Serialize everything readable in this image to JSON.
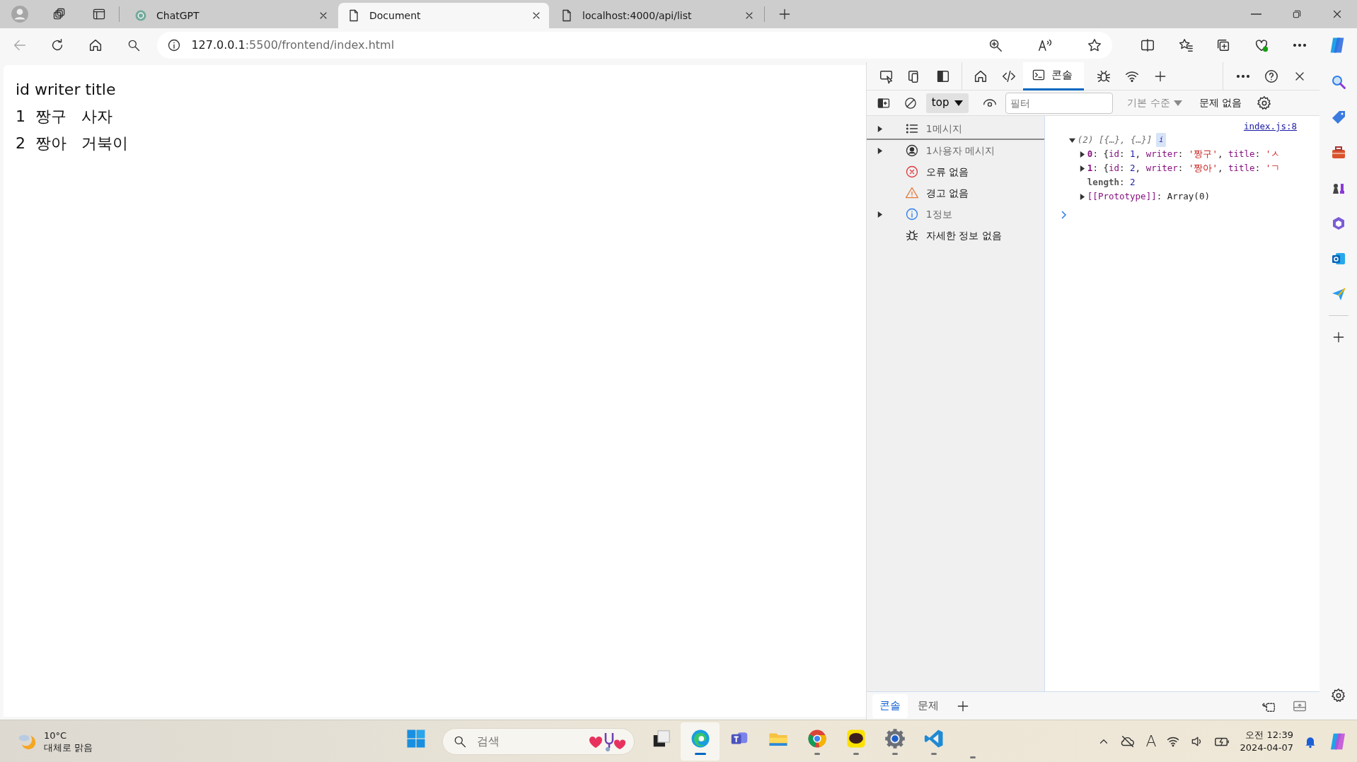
{
  "browser": {
    "tabs": [
      {
        "title": "ChatGPT",
        "kind": "chatgpt",
        "selected": false
      },
      {
        "title": "Document",
        "kind": "page",
        "selected": true
      },
      {
        "title": "localhost:4000/api/list",
        "kind": "page",
        "selected": false
      }
    ],
    "url": {
      "host": "127.0.0.1",
      "path": ":5500/frontend/index.html"
    }
  },
  "page": {
    "lines": [
      "id writer title",
      "1  짱구   사자",
      "2  짱아   거북이"
    ]
  },
  "devtools": {
    "tabs": [
      {
        "label": "콘솔",
        "selected": true
      }
    ],
    "toolbar": {
      "context": "top",
      "filter_placeholder": "필터",
      "levels": "기본 수준",
      "issues": "문제 없음"
    },
    "sidebar": [
      {
        "kind": "list",
        "label": "1메시지",
        "expandable": true,
        "selected": true
      },
      {
        "kind": "user",
        "label": "1사용자 메시지",
        "expandable": true,
        "selected": false
      },
      {
        "kind": "error",
        "label": "오류 없음",
        "expandable": false,
        "selected": false
      },
      {
        "kind": "warning",
        "label": "경고 없음",
        "expandable": false,
        "selected": false
      },
      {
        "kind": "info",
        "label": "1정보",
        "expandable": true,
        "selected": false
      },
      {
        "kind": "verbose",
        "label": "자세한 정보 없음",
        "expandable": false,
        "selected": false
      }
    ],
    "console": {
      "source": "index.js:8",
      "entries": [
        {
          "expandable": true,
          "expanded": true,
          "tokens": [
            {
              "kind": "meta",
              "text": "(2) [{…}, {…}]"
            }
          ],
          "badge": "i",
          "children": [
            {
              "expandable": true,
              "expanded": false,
              "tokens": [
                {
                  "kind": "index",
                  "text": "0"
                },
                {
                  "kind": "punct",
                  "text": ": {"
                },
                {
                  "kind": "key",
                  "text": "id"
                },
                {
                  "kind": "punct",
                  "text": ": "
                },
                {
                  "kind": "number",
                  "text": "1"
                },
                {
                  "kind": "punct",
                  "text": ", "
                },
                {
                  "kind": "key",
                  "text": "writer"
                },
                {
                  "kind": "punct",
                  "text": ": "
                },
                {
                  "kind": "string",
                  "text": "'짱구'"
                },
                {
                  "kind": "punct",
                  "text": ", "
                },
                {
                  "kind": "key",
                  "text": "title"
                },
                {
                  "kind": "punct",
                  "text": ": "
                },
                {
                  "kind": "string",
                  "text": "'ㅅ"
                }
              ]
            },
            {
              "expandable": true,
              "expanded": false,
              "tokens": [
                {
                  "kind": "index",
                  "text": "1"
                },
                {
                  "kind": "punct",
                  "text": ": {"
                },
                {
                  "kind": "key",
                  "text": "id"
                },
                {
                  "kind": "punct",
                  "text": ": "
                },
                {
                  "kind": "number",
                  "text": "2"
                },
                {
                  "kind": "punct",
                  "text": ", "
                },
                {
                  "kind": "key",
                  "text": "writer"
                },
                {
                  "kind": "punct",
                  "text": ": "
                },
                {
                  "kind": "string",
                  "text": "'짱아'"
                },
                {
                  "kind": "punct",
                  "text": ", "
                },
                {
                  "kind": "key",
                  "text": "title"
                },
                {
                  "kind": "punct",
                  "text": ": "
                },
                {
                  "kind": "string",
                  "text": "'ㄱ"
                }
              ]
            },
            {
              "expandable": false,
              "tokens": [
                {
                  "kind": "prop",
                  "text": "length"
                },
                {
                  "kind": "punct",
                  "text": ": "
                },
                {
                  "kind": "number",
                  "text": "2"
                }
              ]
            },
            {
              "expandable": true,
              "expanded": false,
              "tokens": [
                {
                  "kind": "internal",
                  "text": "[[Prototype]]"
                },
                {
                  "kind": "punct",
                  "text": ": Array(0)"
                }
              ]
            }
          ]
        }
      ]
    },
    "drawer_tabs": [
      {
        "label": "콘솔",
        "selected": true
      },
      {
        "label": "문제",
        "selected": false
      }
    ]
  },
  "taskbar": {
    "weather": {
      "temperature": "10°C",
      "condition": "대체로 맑음"
    },
    "search_placeholder": "검색",
    "apps": [
      {
        "kind": "taskview",
        "running": false,
        "active": false
      },
      {
        "kind": "edge",
        "running": true,
        "active": true
      },
      {
        "kind": "teams",
        "running": false,
        "active": false
      },
      {
        "kind": "explorer",
        "running": false,
        "active": false
      },
      {
        "kind": "chrome",
        "running": true,
        "active": false
      },
      {
        "kind": "kakao",
        "running": true,
        "active": false
      },
      {
        "kind": "settings",
        "running": true,
        "active": false
      },
      {
        "kind": "vscode",
        "running": true,
        "active": false
      },
      {
        "kind": "hidden",
        "running": true,
        "active": false
      }
    ],
    "ime": "A",
    "time": "오전 12:39",
    "date": "2024-04-07"
  }
}
